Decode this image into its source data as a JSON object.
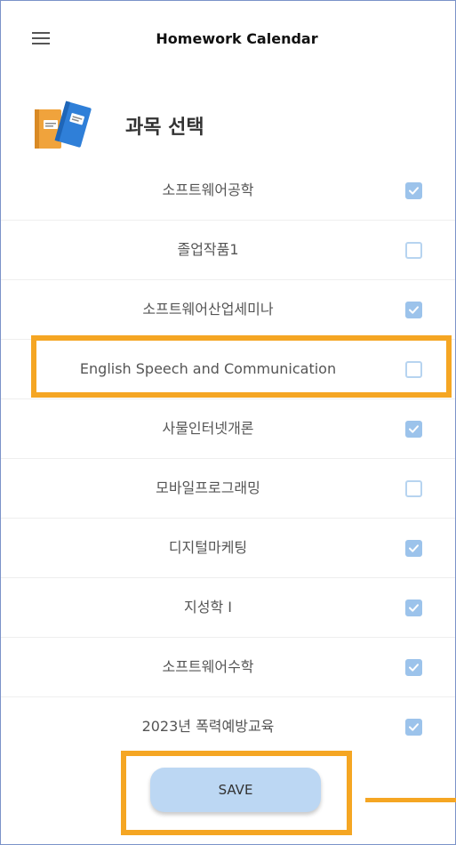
{
  "app": {
    "title": "Homework Calendar"
  },
  "section": {
    "title": "과목 선택"
  },
  "subjects": [
    {
      "name": "소프트웨어공학",
      "checked": true
    },
    {
      "name": "졸업작품1",
      "checked": false
    },
    {
      "name": "소프트웨어산업세미나",
      "checked": true
    },
    {
      "name": "English Speech and Communication",
      "checked": false
    },
    {
      "name": "사물인터넷개론",
      "checked": true
    },
    {
      "name": "모바일프로그래밍",
      "checked": false
    },
    {
      "name": "디지털마케팅",
      "checked": true
    },
    {
      "name": "지성학 I",
      "checked": true
    },
    {
      "name": "소프트웨어수학",
      "checked": true
    },
    {
      "name": "2023년 폭력예방교육",
      "checked": true
    }
  ],
  "save_button": {
    "label": "SAVE"
  },
  "colors": {
    "highlight": "#f5a623",
    "checkbox_checked": "#9cc3eb",
    "save_button_bg": "#bcd7f3"
  }
}
